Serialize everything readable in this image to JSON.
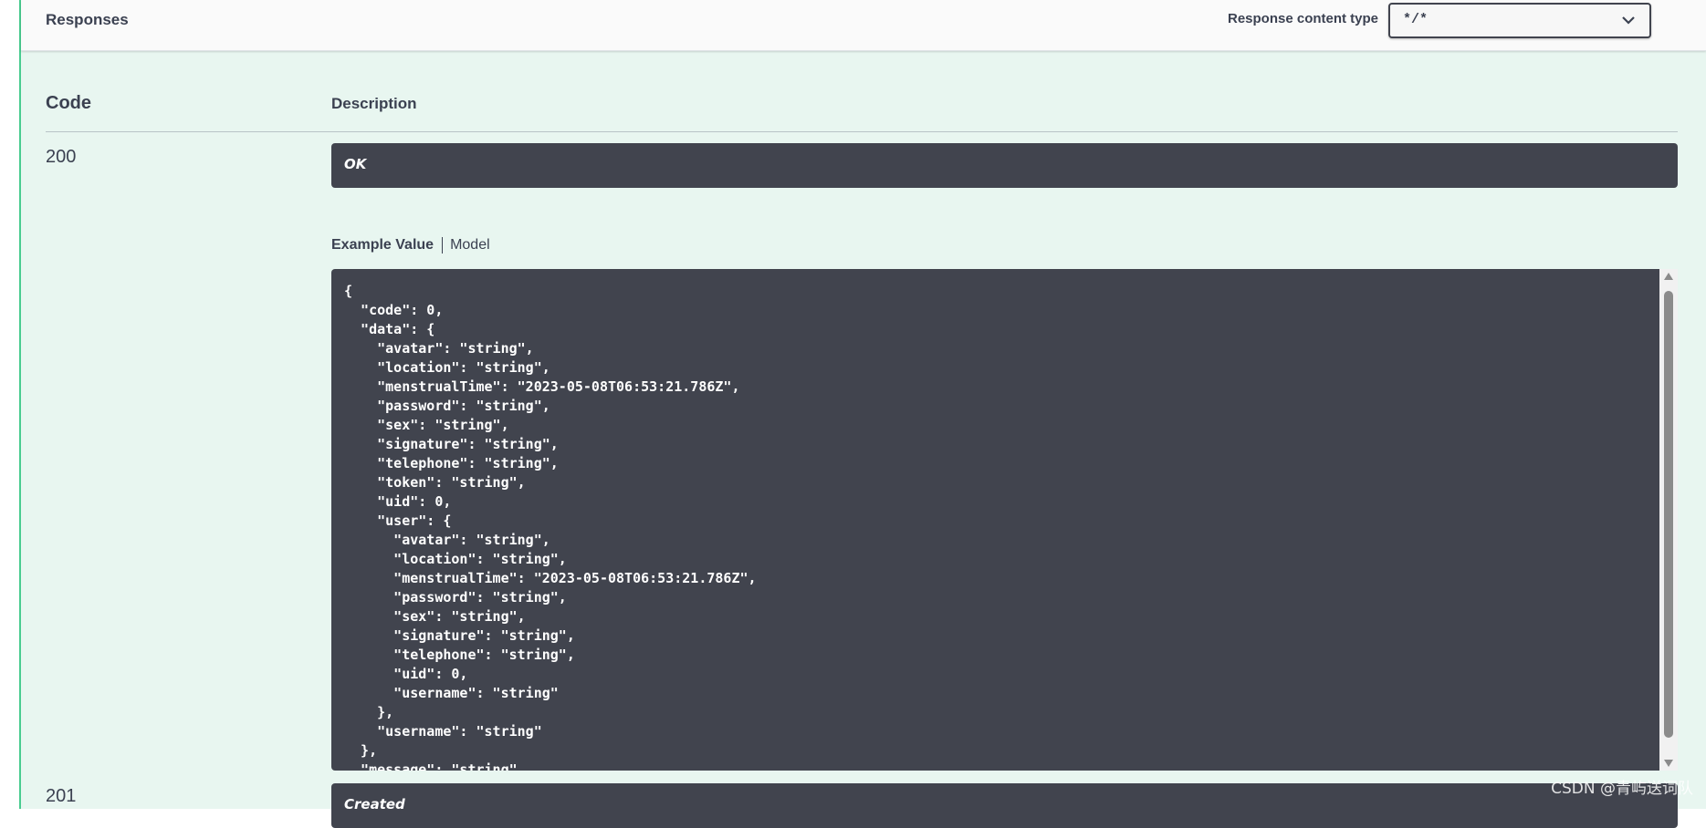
{
  "responses": {
    "title": "Responses",
    "content_type_label": "Response content type",
    "content_type_value": "*/*"
  },
  "table": {
    "code_header": "Code",
    "description_header": "Description"
  },
  "rows": [
    {
      "code": "200",
      "description": "OK"
    },
    {
      "code": "201",
      "description": "Created"
    }
  ],
  "example_tabs": {
    "example_value": "Example Value",
    "model": "Model"
  },
  "example_json": "{\n  \"code\": 0,\n  \"data\": {\n    \"avatar\": \"string\",\n    \"location\": \"string\",\n    \"menstrualTime\": \"2023-05-08T06:53:21.786Z\",\n    \"password\": \"string\",\n    \"sex\": \"string\",\n    \"signature\": \"string\",\n    \"telephone\": \"string\",\n    \"token\": \"string\",\n    \"uid\": 0,\n    \"user\": {\n      \"avatar\": \"string\",\n      \"location\": \"string\",\n      \"menstrualTime\": \"2023-05-08T06:53:21.786Z\",\n      \"password\": \"string\",\n      \"sex\": \"string\",\n      \"signature\": \"string\",\n      \"telephone\": \"string\",\n      \"uid\": 0,\n      \"username\": \"string\"\n    },\n    \"username\": \"string\"\n  },\n  \"message\": \"string\"\n}",
  "watermark": "CSDN @青屿送词队",
  "colors": {
    "panel_bg": "#e8f6f0",
    "panel_border": "#49cc90",
    "code_bg": "#41444e"
  }
}
